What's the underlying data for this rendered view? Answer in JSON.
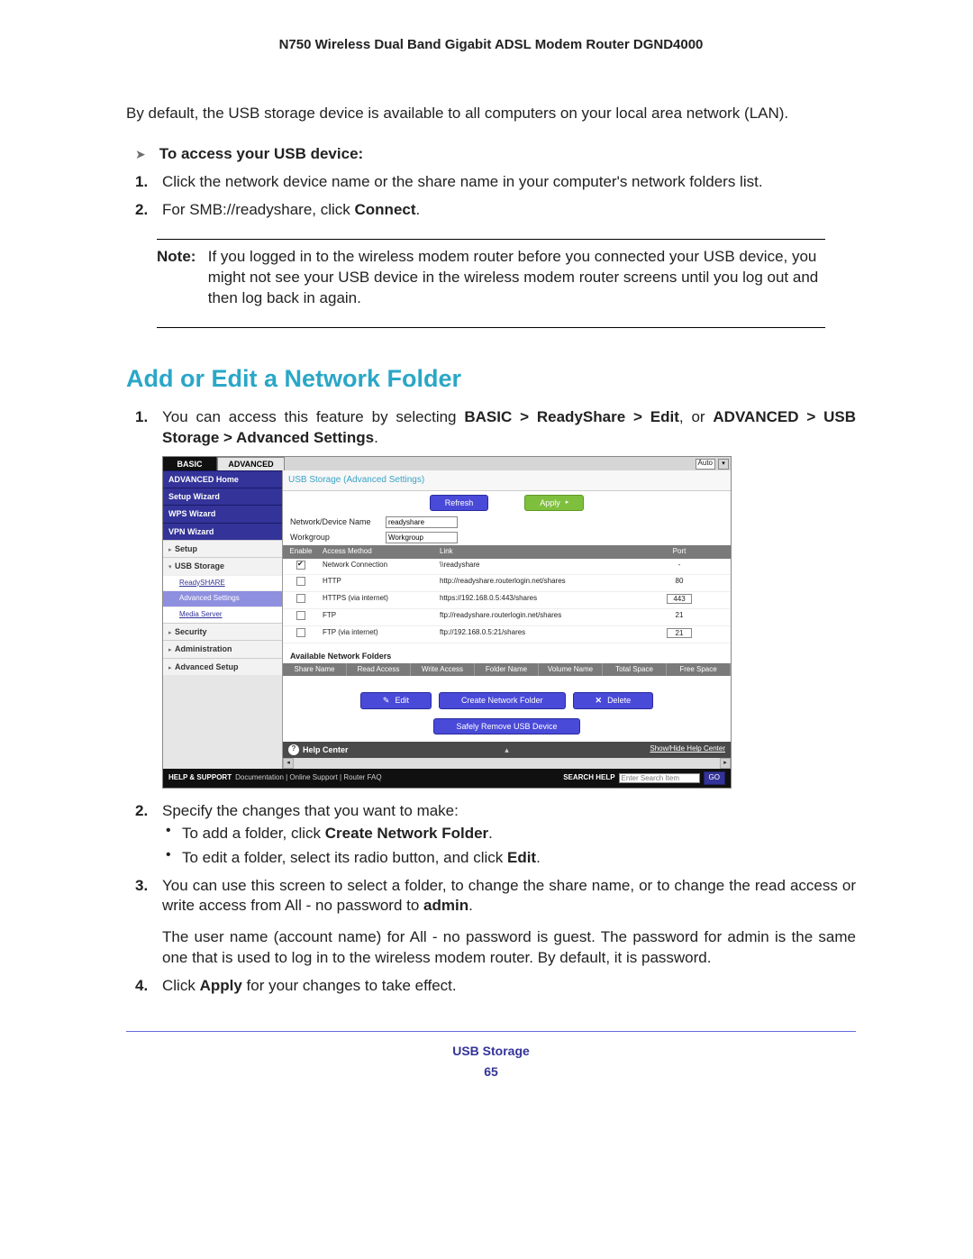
{
  "doc_title": "N750 Wireless Dual Band Gigabit ADSL Modem Router DGND4000",
  "intro": "By default, the USB storage device is available to all computers on your local area network (LAN).",
  "access_heading": "To access your USB device:",
  "access_steps": {
    "s1": "Click the network device name or the share name in your computer's network folders list.",
    "s2_a": "For SMB://readyshare, click ",
    "s2_b": "Connect",
    "s2_c": "."
  },
  "note_label": "Note:",
  "note_body": "If you logged in to the wireless modem router before you connected your USB device, you might not see your USB device in the wireless modem router screens until you log out and then log back in again.",
  "section_title": "Add or Edit a Network Folder",
  "p1_a": "You can access this feature by selecting ",
  "p1_b": "BASIC > ReadyShare > Edit",
  "p1_c": ", or ",
  "p1_d": "ADVANCED > USB Storage > Advanced Settings",
  "p1_e": ".",
  "screenshot": {
    "tabs": {
      "basic": "BASIC",
      "advanced": "ADVANCED"
    },
    "top_dropdown": "Auto",
    "sidebar": {
      "adv_home": "ADVANCED Home",
      "setup_wizard": "Setup Wizard",
      "wps_wizard": "WPS Wizard",
      "vpn_wizard": "VPN Wizard",
      "setup": "Setup",
      "usb_storage": "USB Storage",
      "readyshare": "ReadySHARE",
      "advanced_settings": "Advanced Settings",
      "media_server": "Media Server",
      "security": "Security",
      "administration": "Administration",
      "advanced_setup": "Advanced Setup"
    },
    "main_title": "USB Storage (Advanced Settings)",
    "buttons": {
      "refresh": "Refresh",
      "apply": "Apply"
    },
    "form": {
      "net_name_label": "Network/Device Name",
      "net_name_value": "readyshare",
      "workgroup_label": "Workgroup",
      "workgroup_value": "Workgroup"
    },
    "grid_headers": {
      "enable": "Enable",
      "method": "Access Method",
      "link": "Link",
      "port": "Port"
    },
    "rows": [
      {
        "en": true,
        "method": "Network Connection",
        "link": "\\\\readyshare",
        "port": "-",
        "input": false
      },
      {
        "en": false,
        "method": "HTTP",
        "link": "http://readyshare.routerlogin.net/shares",
        "port": "80",
        "input": false
      },
      {
        "en": false,
        "method": "HTTPS (via internet)",
        "link": "https://192.168.0.5:443/shares",
        "port": "443",
        "input": true
      },
      {
        "en": false,
        "method": "FTP",
        "link": "ftp://readyshare.routerlogin.net/shares",
        "port": "21",
        "input": false
      },
      {
        "en": false,
        "method": "FTP (via internet)",
        "link": "ftp://192.168.0.5:21/shares",
        "port": "21",
        "input": true
      }
    ],
    "avail_label": "Available Network Folders",
    "grid2_headers": {
      "share": "Share Name",
      "read": "Read Access",
      "write": "Write Access",
      "folder": "Folder Name",
      "volume": "Volume Name",
      "total": "Total Space",
      "free": "Free Space"
    },
    "actions": {
      "edit": "Edit",
      "create": "Create Network Folder",
      "delete": "Delete"
    },
    "safe_remove": "Safely Remove USB Device",
    "help_center": "Help Center",
    "show_hide": "Show/Hide Help Center",
    "support_label": "HELP & SUPPORT",
    "support_links": "Documentation | Online Support | Router FAQ",
    "search_label": "SEARCH HELP",
    "search_placeholder": "Enter Search Item",
    "go": "GO"
  },
  "p2": "Specify the changes that you want to make:",
  "bul1_a": "To add a folder, click ",
  "bul1_b": "Create Network Folder",
  "bul1_c": ".",
  "bul2_a": "To edit a folder, select its radio button, and click ",
  "bul2_b": "Edit",
  "bul2_c": ".",
  "p3_a": "You can use this screen to select a folder, to change the share name, or to change the read access or write access from All - no password to ",
  "p3_b": "admin",
  "p3_c": ".",
  "p3_2": "The user name (account name) for All - no password is guest. The password for admin is the same one that is used to log in to the wireless modem router. By default, it is password.",
  "p4_a": "Click ",
  "p4_b": "Apply",
  "p4_c": " for your changes to take effect.",
  "footer_title": "USB Storage",
  "footer_page": "65"
}
